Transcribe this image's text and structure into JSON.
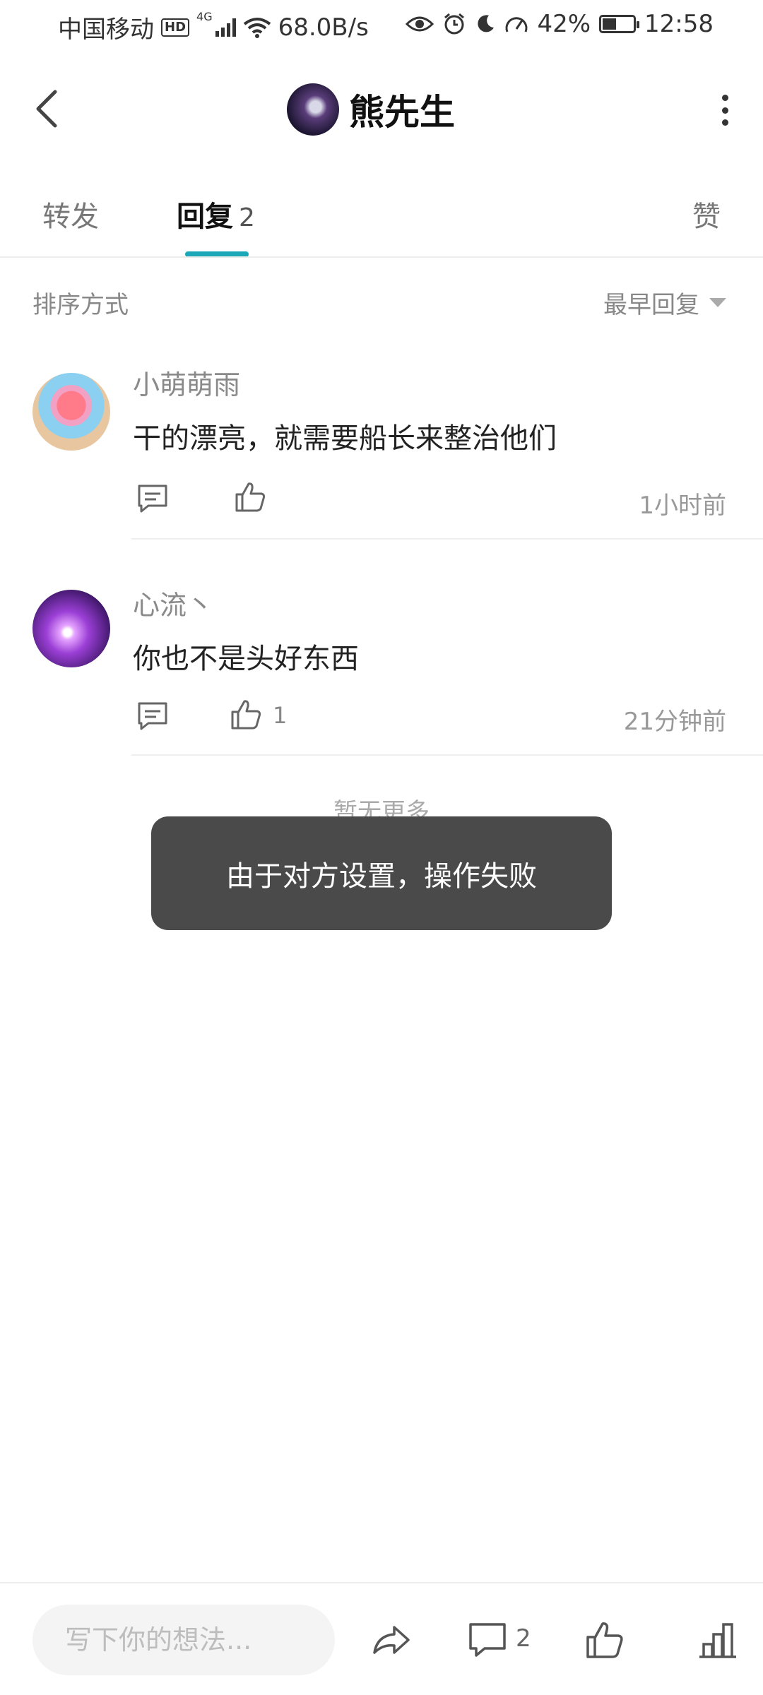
{
  "status_bar": {
    "carrier": "中国移动",
    "hd": "HD",
    "network": "4G",
    "speed": "68.0B/s",
    "battery": "42%",
    "time": "12:58"
  },
  "header": {
    "title": "熊先生"
  },
  "tabs": {
    "forward": "转发",
    "reply": "回复",
    "reply_count": "2",
    "like": "赞"
  },
  "sort": {
    "label": "排序方式",
    "value": "最早回复"
  },
  "comments": [
    {
      "name": "小萌萌雨",
      "text": "干的漂亮，就需要船长来整治他们",
      "time": "1小时前",
      "likes": ""
    },
    {
      "name": "心流丶",
      "text": "你也不是头好东西",
      "time": "21分钟前",
      "likes": "1"
    }
  ],
  "no_more": "暂无更多",
  "toast": "由于对方设置，操作失败",
  "bottom_bar": {
    "placeholder": "写下你的想法...",
    "comment_count": "2"
  },
  "colors": {
    "accent": "#1aa8b8",
    "toast_bg": "#4a4a4a"
  }
}
